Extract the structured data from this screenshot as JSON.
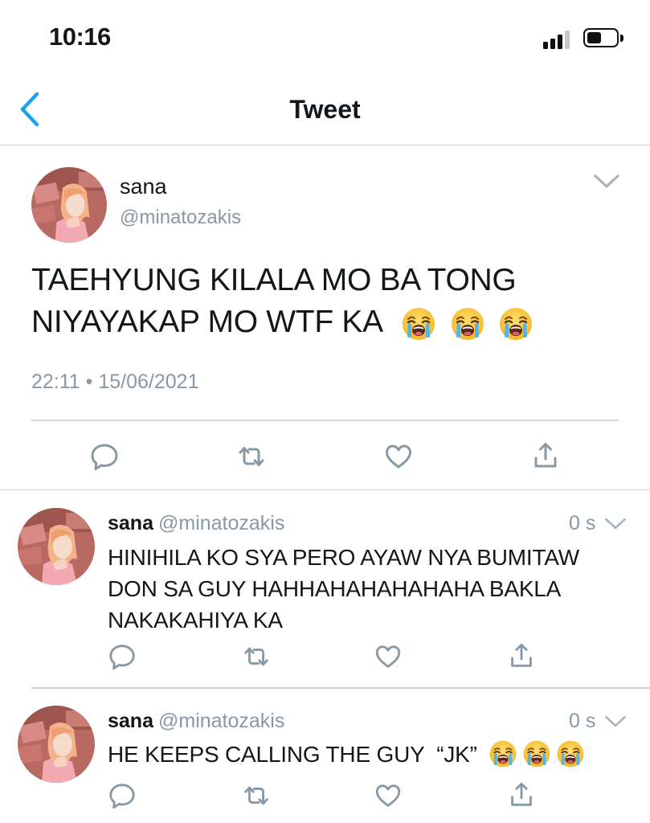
{
  "status_bar": {
    "time": "10:16"
  },
  "nav": {
    "title": "Tweet"
  },
  "colors": {
    "accent": "#1da1f2",
    "secondary_text": "#8899a6",
    "divider": "#d2d5d9"
  },
  "main_tweet": {
    "name": "sana",
    "handle": "@minatozakis",
    "text_line1": "TAEHYUNG KILALA MO BA TONG",
    "text_line2": "NIYAYAKAP MO WTF KA",
    "emoji": "loudly-crying-face",
    "meta": "22:11 • 15/06/2021"
  },
  "replies": [
    {
      "name": "sana",
      "handle": "@minatozakis",
      "time": "0 s",
      "text_lines": [
        "HINIHILA KO SYA PERO AYAW NYA BUMITAW",
        "DON SA GUY HAHHAHAHAHAHAHA BAKLA",
        "NAKAKAHIYA KA"
      ]
    },
    {
      "name": "sana",
      "handle": "@minatozakis",
      "time": "0 s",
      "text": "HE KEEPS CALLING THE GUY  “JK”",
      "emoji": "loudly-crying-face"
    }
  ],
  "icons": [
    "back-chevron-icon",
    "chevron-down-icon",
    "reply-icon",
    "retweet-icon",
    "like-icon",
    "share-icon"
  ]
}
